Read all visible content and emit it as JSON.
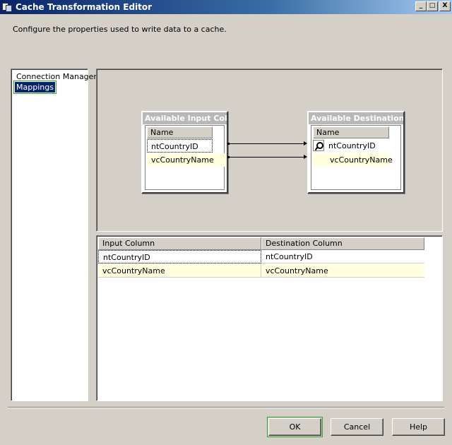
{
  "window": {
    "title": "Cache Transformation Editor",
    "buttons": {
      "minimize": "_",
      "maximize": "□",
      "close": "X"
    }
  },
  "description": "Configure the properties used to write data to a cache.",
  "nav": {
    "items": [
      {
        "label": "Connection Manager",
        "selected": false
      },
      {
        "label": "Mappings",
        "selected": true
      }
    ]
  },
  "diagram": {
    "input_box": {
      "title": "Available Input Col...",
      "column_header": "Name",
      "rows": [
        "ntCountryID",
        "vcCountryName"
      ]
    },
    "dest_box": {
      "title": "Available Destination...",
      "column_header": "Name",
      "rows": [
        "ntCountryID",
        "vcCountryName"
      ],
      "key_icon": "key-icon"
    }
  },
  "grid": {
    "headers": [
      "Input Column",
      "Destination Column"
    ],
    "rows": [
      [
        "ntCountryID",
        "ntCountryID"
      ],
      [
        "vcCountryName",
        "vcCountryName"
      ]
    ]
  },
  "buttons": {
    "ok": "OK",
    "cancel": "Cancel",
    "help": "Help"
  },
  "colors": {
    "title_bar": "#0a246a",
    "selection": "#0a246a",
    "focus_outline": "#3aa03a",
    "alt_row": "#ffffe0"
  }
}
